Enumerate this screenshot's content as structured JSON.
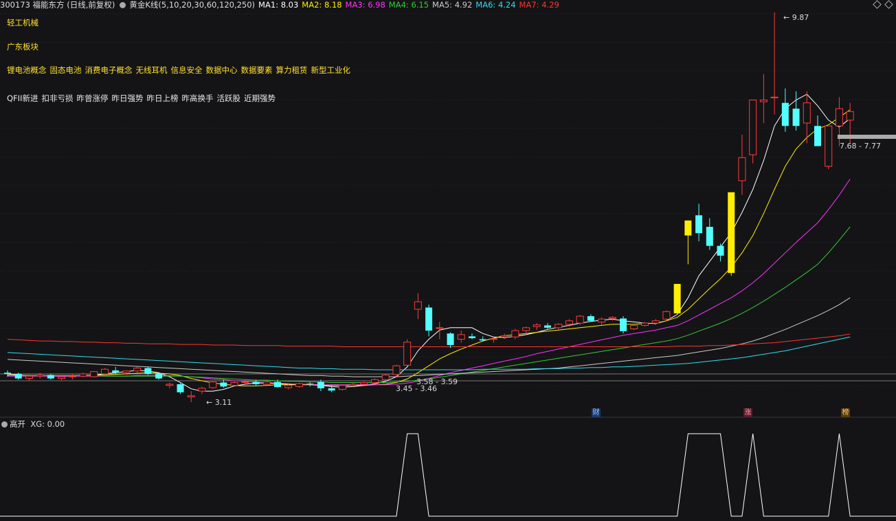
{
  "header": {
    "code_name": "300173 福能东方 (日线,前复权)",
    "indicator": "黄金K线(5,10,20,30,60,120,250)",
    "ma": [
      {
        "label": "MA1:",
        "value": "8.03",
        "color": "#ffffff"
      },
      {
        "label": "MA2:",
        "value": "8.18",
        "color": "#ffee00"
      },
      {
        "label": "MA3:",
        "value": "6.98",
        "color": "#ff33ff"
      },
      {
        "label": "MA4:",
        "value": "6.15",
        "color": "#33cc33"
      },
      {
        "label": "MA5:",
        "value": "4.92",
        "color": "#cccccc"
      },
      {
        "label": "MA6:",
        "value": "4.24",
        "color": "#33ddee"
      },
      {
        "label": "MA7:",
        "value": "4.29",
        "color": "#ff3333"
      }
    ]
  },
  "tags": {
    "line1": [
      "轻工机械"
    ],
    "line2": [
      "广东板块"
    ],
    "line3": [
      "锂电池概念",
      "固态电池",
      "消费电子概念",
      "无线耳机",
      "信息安全",
      "数据中心",
      "数据要素",
      "算力租赁",
      "新型工业化"
    ],
    "line4": [
      "QFII新进",
      "扣非亏损",
      "昨曾涨停",
      "昨日强势",
      "昨日上榜",
      "昨高换手",
      "活跃股",
      "近期强势"
    ]
  },
  "annotations": {
    "high": "9.87",
    "low": "3.11",
    "range1": "3.58 - 3.59",
    "range2": "3.45 - 3.46",
    "price_range": "7.68 - 7.77"
  },
  "markers": [
    {
      "text": "财",
      "bg": "#1c3a6b",
      "color": "#9fc4ff"
    },
    {
      "text": "涨",
      "bg": "#5a1c2c",
      "color": "#ff9aa8"
    },
    {
      "text": "榜",
      "bg": "#5a3a10",
      "color": "#ffcc66"
    }
  ],
  "sub_panel": {
    "title": "高开",
    "xg_label": "XG: 0.00"
  },
  "colors": {
    "up": "#ff3b3b",
    "down": "#54ffff",
    "limit_up": "#ffee00",
    "bg": "#141416",
    "grid": "#2a2a2e"
  },
  "chart_data": {
    "type": "candlestick",
    "ohlc": [
      [
        3.62,
        3.66,
        3.55,
        3.6
      ],
      [
        3.6,
        3.62,
        3.5,
        3.52
      ],
      [
        3.52,
        3.6,
        3.48,
        3.56
      ],
      [
        3.56,
        3.62,
        3.52,
        3.58
      ],
      [
        3.58,
        3.6,
        3.5,
        3.52
      ],
      [
        3.52,
        3.58,
        3.49,
        3.55
      ],
      [
        3.55,
        3.6,
        3.5,
        3.56
      ],
      [
        3.56,
        3.62,
        3.54,
        3.6
      ],
      [
        3.55,
        3.65,
        3.54,
        3.64
      ],
      [
        3.6,
        3.7,
        3.58,
        3.68
      ],
      [
        3.66,
        3.72,
        3.6,
        3.62
      ],
      [
        3.62,
        3.66,
        3.58,
        3.65
      ],
      [
        3.65,
        3.72,
        3.62,
        3.7
      ],
      [
        3.7,
        3.72,
        3.58,
        3.6
      ],
      [
        3.6,
        3.62,
        3.5,
        3.52
      ],
      [
        3.4,
        3.45,
        3.35,
        3.42
      ],
      [
        3.42,
        3.44,
        3.25,
        3.28
      ],
      [
        3.2,
        3.3,
        3.11,
        3.22
      ],
      [
        3.3,
        3.38,
        3.25,
        3.35
      ],
      [
        3.36,
        3.48,
        3.34,
        3.46
      ],
      [
        3.45,
        3.5,
        3.36,
        3.38
      ],
      [
        3.4,
        3.48,
        3.38,
        3.45
      ],
      [
        3.45,
        3.5,
        3.42,
        3.46
      ],
      [
        3.46,
        3.5,
        3.4,
        3.42
      ],
      [
        3.42,
        3.48,
        3.4,
        3.46
      ],
      [
        3.46,
        3.5,
        3.36,
        3.37
      ],
      [
        3.36,
        3.42,
        3.33,
        3.4
      ],
      [
        3.38,
        3.45,
        3.36,
        3.43
      ],
      [
        3.43,
        3.46,
        3.38,
        3.42
      ],
      [
        3.46,
        3.5,
        3.3,
        3.35
      ],
      [
        3.35,
        3.4,
        3.28,
        3.31
      ],
      [
        3.33,
        3.42,
        3.31,
        3.4
      ],
      [
        3.4,
        3.45,
        3.38,
        3.42
      ],
      [
        3.42,
        3.47,
        3.4,
        3.45
      ],
      [
        3.45,
        3.52,
        3.44,
        3.5
      ],
      [
        3.5,
        3.6,
        3.48,
        3.58
      ],
      [
        3.59,
        3.76,
        3.55,
        3.74
      ],
      [
        3.75,
        4.2,
        3.74,
        4.15
      ],
      [
        4.72,
        5.0,
        4.55,
        4.85
      ],
      [
        4.75,
        4.8,
        4.25,
        4.35
      ],
      [
        4.4,
        4.5,
        4.2,
        4.4
      ],
      [
        4.3,
        4.32,
        4.05,
        4.1
      ],
      [
        4.2,
        4.35,
        4.14,
        4.28
      ],
      [
        4.25,
        4.3,
        4.2,
        4.22
      ],
      [
        4.2,
        4.25,
        4.16,
        4.18
      ],
      [
        4.2,
        4.24,
        4.14,
        4.21
      ],
      [
        4.24,
        4.3,
        4.2,
        4.26
      ],
      [
        4.24,
        4.38,
        4.2,
        4.35
      ],
      [
        4.35,
        4.42,
        4.28,
        4.4
      ],
      [
        4.42,
        4.48,
        4.36,
        4.45
      ],
      [
        4.44,
        4.48,
        4.38,
        4.4
      ],
      [
        4.4,
        4.48,
        4.36,
        4.46
      ],
      [
        4.46,
        4.55,
        4.42,
        4.52
      ],
      [
        4.48,
        4.62,
        4.45,
        4.6
      ],
      [
        4.6,
        4.63,
        4.5,
        4.52
      ],
      [
        4.5,
        4.58,
        4.45,
        4.55
      ],
      [
        4.56,
        4.6,
        4.52,
        4.58
      ],
      [
        4.56,
        4.6,
        4.3,
        4.34
      ],
      [
        4.38,
        4.45,
        4.36,
        4.44
      ],
      [
        4.44,
        4.5,
        4.42,
        4.48
      ],
      [
        4.48,
        4.55,
        4.45,
        4.52
      ],
      [
        4.55,
        4.7,
        4.52,
        4.68
      ],
      [
        4.65,
        5.16,
        4.65,
        5.16
      ],
      [
        6.0,
        6.26,
        5.5,
        6.26
      ],
      [
        6.35,
        6.55,
        5.9,
        6.04
      ],
      [
        6.15,
        6.3,
        5.75,
        5.82
      ],
      [
        5.82,
        5.86,
        5.55,
        5.65
      ],
      [
        5.35,
        5.9,
        5.3,
        6.75
      ],
      [
        6.95,
        7.75,
        6.7,
        7.35
      ],
      [
        7.4,
        8.3,
        7.25,
        8.35
      ],
      [
        8.32,
        8.8,
        7.95,
        8.35
      ],
      [
        8.4,
        9.87,
        8.1,
        8.4
      ],
      [
        8.3,
        8.55,
        7.8,
        7.9
      ],
      [
        8.2,
        8.5,
        7.82,
        7.9
      ],
      [
        7.95,
        8.5,
        7.6,
        8.3
      ],
      [
        7.9,
        8.08,
        7.55,
        7.55
      ],
      [
        7.2,
        7.85,
        7.15,
        7.9
      ],
      [
        7.9,
        8.4,
        7.55,
        8.2
      ],
      [
        8.0,
        8.3,
        7.6,
        8.15
      ]
    ],
    "limit_up_indices": [
      62,
      63,
      67
    ],
    "ma_series": [
      {
        "name": "MA1",
        "color": "#ffffff",
        "values": [
          3.6,
          3.58,
          3.57,
          3.57,
          3.56,
          3.56,
          3.56,
          3.57,
          3.58,
          3.6,
          3.62,
          3.64,
          3.66,
          3.65,
          3.62,
          3.55,
          3.45,
          3.34,
          3.3,
          3.3,
          3.33,
          3.39,
          3.42,
          3.44,
          3.44,
          3.43,
          3.42,
          3.42,
          3.42,
          3.4,
          3.38,
          3.37,
          3.38,
          3.4,
          3.43,
          3.47,
          3.55,
          3.72,
          4.0,
          4.2,
          4.36,
          4.4,
          4.4,
          4.4,
          4.3,
          4.24,
          4.23,
          4.25,
          4.28,
          4.32,
          4.37,
          4.41,
          4.44,
          4.48,
          4.51,
          4.53,
          4.55,
          4.52,
          4.5,
          4.48,
          4.47,
          4.52,
          4.63,
          4.92,
          5.3,
          5.55,
          5.8,
          6.05,
          6.4,
          6.8,
          7.3,
          7.9,
          8.2,
          8.35,
          8.45,
          8.25,
          8.0,
          7.88,
          8.03
        ]
      },
      {
        "name": "MA2",
        "color": "#ffee00",
        "values": [
          3.58,
          3.57,
          3.57,
          3.57,
          3.57,
          3.57,
          3.57,
          3.57,
          3.58,
          3.58,
          3.59,
          3.6,
          3.61,
          3.62,
          3.61,
          3.6,
          3.57,
          3.52,
          3.48,
          3.44,
          3.42,
          3.4,
          3.39,
          3.39,
          3.4,
          3.41,
          3.41,
          3.41,
          3.41,
          3.4,
          3.4,
          3.4,
          3.4,
          3.4,
          3.41,
          3.42,
          3.45,
          3.51,
          3.62,
          3.74,
          3.86,
          3.95,
          4.03,
          4.1,
          4.17,
          4.22,
          4.26,
          4.28,
          4.3,
          4.32,
          4.34,
          4.36,
          4.38,
          4.4,
          4.42,
          4.44,
          4.46,
          4.46,
          4.46,
          4.47,
          4.48,
          4.52,
          4.58,
          4.72,
          4.9,
          5.08,
          5.25,
          5.45,
          5.7,
          6.0,
          6.38,
          6.8,
          7.2,
          7.5,
          7.7,
          7.85,
          7.92,
          8.05,
          8.18
        ]
      },
      {
        "name": "MA3",
        "color": "#ff33ff",
        "values": [
          3.56,
          3.56,
          3.56,
          3.56,
          3.56,
          3.56,
          3.56,
          3.56,
          3.56,
          3.56,
          3.56,
          3.56,
          3.57,
          3.57,
          3.57,
          3.57,
          3.56,
          3.55,
          3.53,
          3.51,
          3.5,
          3.48,
          3.47,
          3.46,
          3.45,
          3.44,
          3.43,
          3.42,
          3.42,
          3.41,
          3.41,
          3.41,
          3.41,
          3.41,
          3.41,
          3.41,
          3.42,
          3.44,
          3.47,
          3.52,
          3.57,
          3.62,
          3.66,
          3.7,
          3.74,
          3.78,
          3.82,
          3.86,
          3.9,
          3.95,
          3.99,
          4.03,
          4.07,
          4.11,
          4.15,
          4.19,
          4.23,
          4.27,
          4.3,
          4.33,
          4.36,
          4.4,
          4.44,
          4.52,
          4.62,
          4.72,
          4.82,
          4.92,
          5.04,
          5.18,
          5.34,
          5.52,
          5.7,
          5.88,
          6.05,
          6.22,
          6.45,
          6.7,
          6.98
        ]
      },
      {
        "name": "MA4",
        "color": "#33cc33",
        "values": [
          3.57,
          3.57,
          3.57,
          3.57,
          3.57,
          3.57,
          3.57,
          3.57,
          3.57,
          3.56,
          3.56,
          3.56,
          3.56,
          3.56,
          3.56,
          3.56,
          3.56,
          3.55,
          3.54,
          3.53,
          3.52,
          3.51,
          3.5,
          3.49,
          3.49,
          3.48,
          3.47,
          3.47,
          3.46,
          3.46,
          3.45,
          3.45,
          3.45,
          3.45,
          3.45,
          3.45,
          3.46,
          3.47,
          3.49,
          3.51,
          3.54,
          3.57,
          3.6,
          3.63,
          3.66,
          3.69,
          3.72,
          3.75,
          3.78,
          3.81,
          3.84,
          3.87,
          3.9,
          3.93,
          3.96,
          3.99,
          4.02,
          4.05,
          4.08,
          4.11,
          4.14,
          4.17,
          4.21,
          4.27,
          4.34,
          4.41,
          4.48,
          4.56,
          4.65,
          4.75,
          4.86,
          4.98,
          5.1,
          5.23,
          5.36,
          5.5,
          5.7,
          5.92,
          6.15
        ]
      },
      {
        "name": "MA5",
        "color": "#cccccc",
        "values": [
          3.85,
          3.84,
          3.83,
          3.82,
          3.81,
          3.8,
          3.79,
          3.78,
          3.77,
          3.76,
          3.75,
          3.74,
          3.73,
          3.72,
          3.71,
          3.7,
          3.69,
          3.68,
          3.67,
          3.66,
          3.65,
          3.64,
          3.63,
          3.62,
          3.61,
          3.6,
          3.59,
          3.58,
          3.57,
          3.57,
          3.56,
          3.56,
          3.55,
          3.55,
          3.55,
          3.55,
          3.55,
          3.56,
          3.57,
          3.58,
          3.59,
          3.6,
          3.61,
          3.62,
          3.63,
          3.64,
          3.65,
          3.66,
          3.67,
          3.68,
          3.69,
          3.7,
          3.72,
          3.74,
          3.76,
          3.78,
          3.8,
          3.82,
          3.84,
          3.86,
          3.88,
          3.9,
          3.92,
          3.95,
          3.98,
          4.01,
          4.04,
          4.08,
          4.12,
          4.17,
          4.23,
          4.3,
          4.37,
          4.45,
          4.53,
          4.61,
          4.7,
          4.8,
          4.92
        ]
      },
      {
        "name": "MA6",
        "color": "#33ddee",
        "values": [
          3.97,
          3.96,
          3.95,
          3.94,
          3.93,
          3.92,
          3.91,
          3.9,
          3.89,
          3.88,
          3.87,
          3.86,
          3.85,
          3.84,
          3.83,
          3.82,
          3.81,
          3.8,
          3.79,
          3.78,
          3.77,
          3.76,
          3.75,
          3.74,
          3.73,
          3.72,
          3.71,
          3.7,
          3.7,
          3.69,
          3.69,
          3.68,
          3.68,
          3.68,
          3.67,
          3.67,
          3.67,
          3.67,
          3.67,
          3.67,
          3.67,
          3.67,
          3.67,
          3.67,
          3.68,
          3.68,
          3.68,
          3.68,
          3.68,
          3.69,
          3.69,
          3.69,
          3.7,
          3.7,
          3.71,
          3.71,
          3.72,
          3.72,
          3.73,
          3.74,
          3.75,
          3.76,
          3.77,
          3.78,
          3.8,
          3.82,
          3.84,
          3.86,
          3.88,
          3.91,
          3.94,
          3.97,
          4.0,
          4.04,
          4.08,
          4.12,
          4.16,
          4.2,
          4.24
        ]
      },
      {
        "name": "MA7",
        "color": "#ff3333",
        "values": [
          4.2,
          4.19,
          4.18,
          4.17,
          4.17,
          4.16,
          4.16,
          4.15,
          4.15,
          4.14,
          4.14,
          4.13,
          4.13,
          4.12,
          4.12,
          4.12,
          4.11,
          4.11,
          4.11,
          4.1,
          4.1,
          4.1,
          4.09,
          4.09,
          4.09,
          4.09,
          4.08,
          4.08,
          4.08,
          4.08,
          4.08,
          4.07,
          4.07,
          4.07,
          4.07,
          4.07,
          4.07,
          4.07,
          4.07,
          4.07,
          4.07,
          4.07,
          4.07,
          4.07,
          4.07,
          4.07,
          4.07,
          4.07,
          4.07,
          4.07,
          4.07,
          4.07,
          4.07,
          4.07,
          4.07,
          4.07,
          4.07,
          4.07,
          4.07,
          4.07,
          4.07,
          4.07,
          4.08,
          4.08,
          4.08,
          4.09,
          4.09,
          4.1,
          4.11,
          4.12,
          4.13,
          4.14,
          4.16,
          4.18,
          4.2,
          4.22,
          4.24,
          4.26,
          4.29
        ]
      }
    ],
    "xg_signal": [
      0,
      0,
      0,
      0,
      0,
      0,
      0,
      0,
      0,
      0,
      0,
      0,
      0,
      0,
      0,
      0,
      0,
      0,
      0,
      0,
      0,
      0,
      0,
      0,
      0,
      0,
      0,
      0,
      0,
      0,
      0,
      0,
      0,
      0,
      0,
      0,
      0,
      1,
      1,
      0,
      0,
      0,
      0,
      0,
      0,
      0,
      0,
      0,
      0,
      0,
      0,
      0,
      0,
      0,
      0,
      0,
      0,
      0,
      0,
      0,
      0,
      0,
      0,
      1,
      1,
      1,
      1,
      0,
      0,
      1,
      0,
      0,
      0,
      0,
      0,
      0,
      0,
      1,
      0
    ]
  }
}
